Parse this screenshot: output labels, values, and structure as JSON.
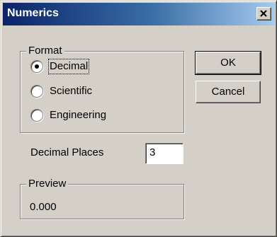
{
  "window": {
    "title": "Numerics",
    "close_icon": "close-x-icon"
  },
  "format_group": {
    "label": "Format",
    "options": [
      {
        "label": "Decimal",
        "selected": true
      },
      {
        "label": "Scientific",
        "selected": false
      },
      {
        "label": "Engineering",
        "selected": false
      }
    ]
  },
  "buttons": {
    "ok": "OK",
    "cancel": "Cancel"
  },
  "decimal_places": {
    "label": "Decimal Places",
    "value": "3"
  },
  "preview": {
    "label": "Preview",
    "value": "0.000"
  },
  "colors": {
    "face": "#d4d0c8",
    "title_start": "#0a246a",
    "title_end": "#a6caf0",
    "title_text": "#ffffff"
  }
}
